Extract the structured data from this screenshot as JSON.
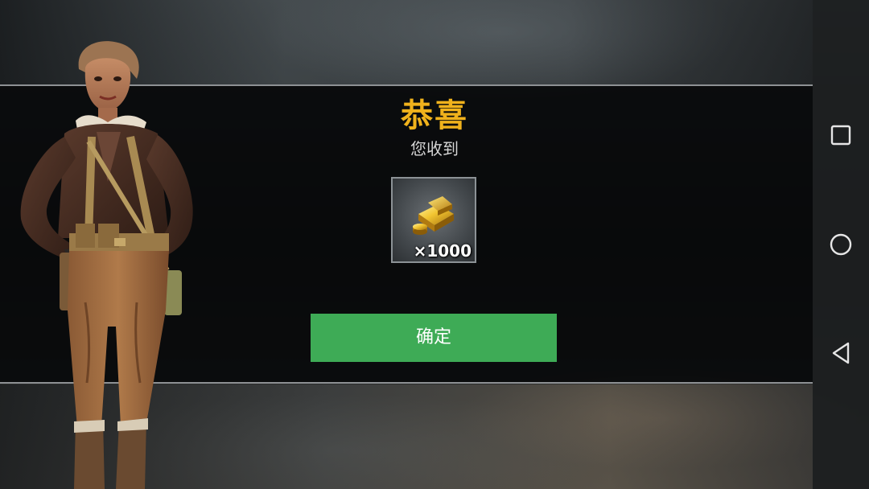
{
  "dialog": {
    "title": "恭喜",
    "subtitle": "您收到",
    "reward": {
      "icon": "gold-bars-icon",
      "quantity": "×1000"
    },
    "confirm_label": "确定"
  },
  "navigation": {
    "buttons": [
      "recent-apps-icon",
      "home-icon",
      "back-icon"
    ]
  },
  "colors": {
    "title": "#f0b21c",
    "confirm_button": "#3eab56",
    "band_border": "#8e9194"
  }
}
